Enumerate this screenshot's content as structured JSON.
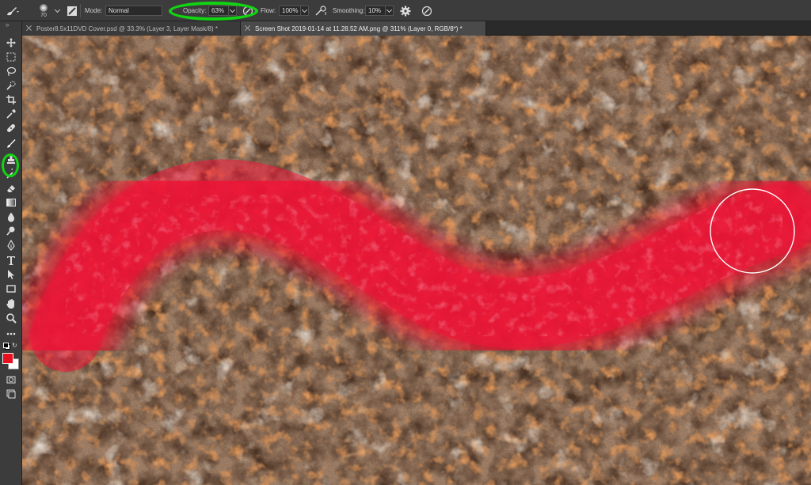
{
  "options_bar": {
    "brush_size": "70",
    "mode_label": "Mode:",
    "mode_value": "Normal",
    "opacity_label": "Opacity:",
    "opacity_value": "63%",
    "flow_label": "Flow:",
    "flow_value": "100%",
    "smoothing_label": "Smoothing:",
    "smoothing_value": "10%"
  },
  "tabs": [
    {
      "label": "Poster8.5x11DVD Cover.psd @ 33.3% (Layer 3, Layer Mask/8) *",
      "active": false
    },
    {
      "label": "Screen Shot 2019-01-14 at 11.28.52 AM.png @ 311% (Layer 0, RGB/8*) *",
      "active": true
    }
  ],
  "toolbar": {
    "tools": [
      "move-icon",
      "marquee-icon",
      "lasso-icon",
      "quick-select-icon",
      "crop-icon",
      "eyedropper-icon",
      "healing-icon",
      "brush-icon",
      "clone-stamp-icon",
      "history-brush-icon",
      "eraser-icon",
      "gradient-icon",
      "blur-icon",
      "dodge-icon",
      "pen-icon",
      "type-icon",
      "path-select-icon",
      "rectangle-icon",
      "hand-icon",
      "zoom-icon",
      "more-tools-icon"
    ],
    "selected_tool": "brush-icon",
    "foreground_color": "#e8101e",
    "background_color": "#ffffff"
  },
  "colors": {
    "highlight": "#12d412",
    "paint_stroke": "#e8102e",
    "app_chrome": "#3c3c3c"
  }
}
